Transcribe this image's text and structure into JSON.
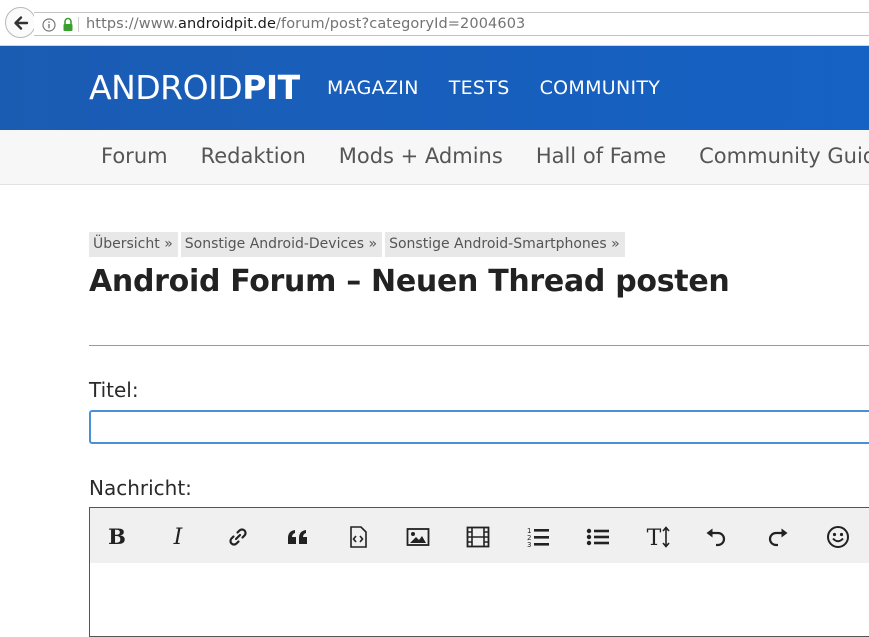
{
  "browser": {
    "url_scheme": "https://www.",
    "url_host": "androidpit.de",
    "url_path": "/forum/post?categoryId=2004603",
    "icons": [
      "back-arrow-icon",
      "info-icon",
      "lock-icon"
    ]
  },
  "header": {
    "logo_part1": "ANDROID",
    "logo_part2": "PIT",
    "nav": [
      "MAGAZIN",
      "TESTS",
      "COMMUNITY"
    ],
    "brand_color": "#1559b8"
  },
  "subnav": {
    "items": [
      "Forum",
      "Redaktion",
      "Mods + Admins",
      "Hall of Fame",
      "Community Guide"
    ]
  },
  "breadcrumb": [
    "Übersicht »",
    "Sonstige Android-Devices »",
    "Sonstige Android-Smartphones »"
  ],
  "page": {
    "title": "Android Forum – Neuen Thread posten"
  },
  "form": {
    "title_label": "Titel:",
    "title_value": "",
    "message_label": "Nachricht:",
    "input_focus_color": "#4a90d9"
  },
  "toolbar": {
    "buttons": [
      "bold-icon",
      "italic-icon",
      "link-icon",
      "quote-icon",
      "code-icon",
      "image-icon",
      "video-icon",
      "ordered-list-icon",
      "unordered-list-icon",
      "text-size-icon",
      "undo-icon",
      "redo-icon",
      "emoji-icon"
    ]
  }
}
